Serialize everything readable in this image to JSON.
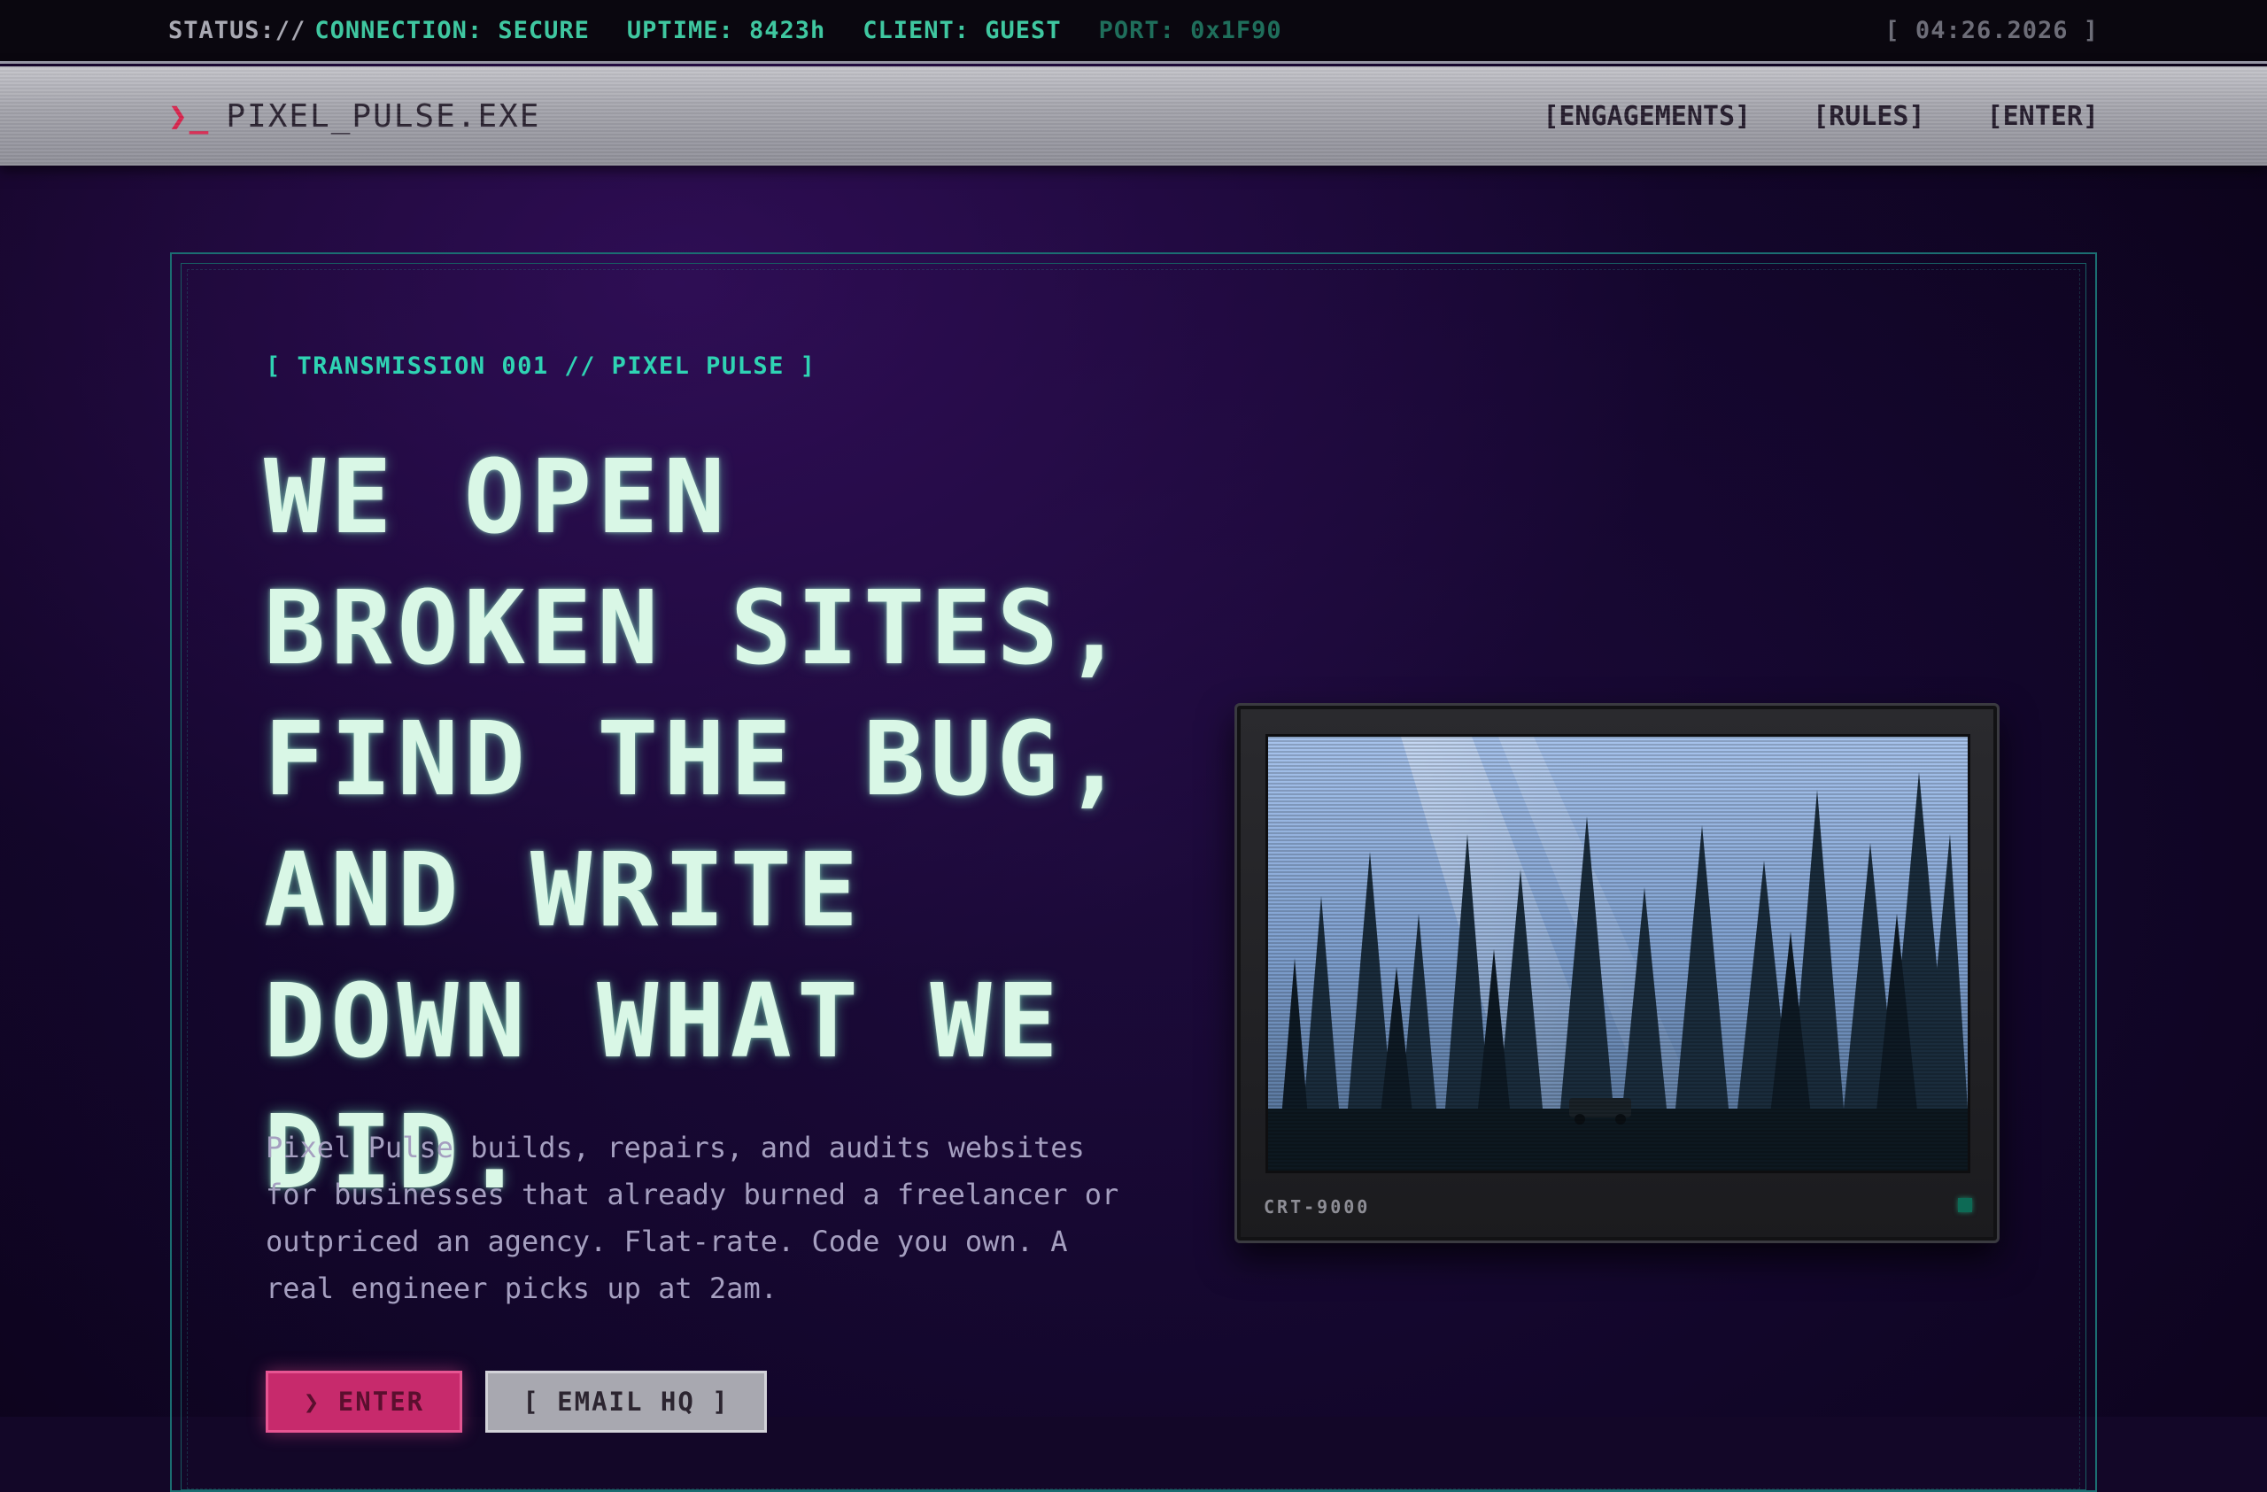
{
  "status_bar": {
    "prefix": "STATUS://",
    "connection": "CONNECTION: SECURE",
    "uptime": "UPTIME: 8423h",
    "client": "CLIENT: GUEST",
    "port": "PORT: 0x1F90",
    "clock": "[ 04:26.2026 ]"
  },
  "navbar": {
    "brand_prompt": "❯_",
    "brand_name": "PIXEL_PULSE.EXE",
    "links": [
      "[ENGAGEMENTS]",
      "[RULES]",
      "[ENTER]"
    ]
  },
  "hero": {
    "kicker": "[ TRANSMISSION 001 // PIXEL PULSE ]",
    "headline": "WE OPEN BROKEN SITES, FIND THE BUG, AND WRITE DOWN WHAT WE DID.",
    "intro": "Pixel Pulse builds, repairs, and audits websites for businesses that already burned a freelancer or outpriced an agency. Flat-rate. Code you own. A real engineer picks up at 2am.",
    "primary_button": "❯ ENTER",
    "secondary_button": "[ EMAIL HQ ]"
  },
  "monitor": {
    "label": "CRT-9000",
    "image_alt": "Forest of tall pine trees at dawn with sunlight beams and a car parked below"
  },
  "colors": {
    "accent_teal": "#2fd3b3",
    "accent_pink": "#c72a6c",
    "background": "#130728"
  }
}
